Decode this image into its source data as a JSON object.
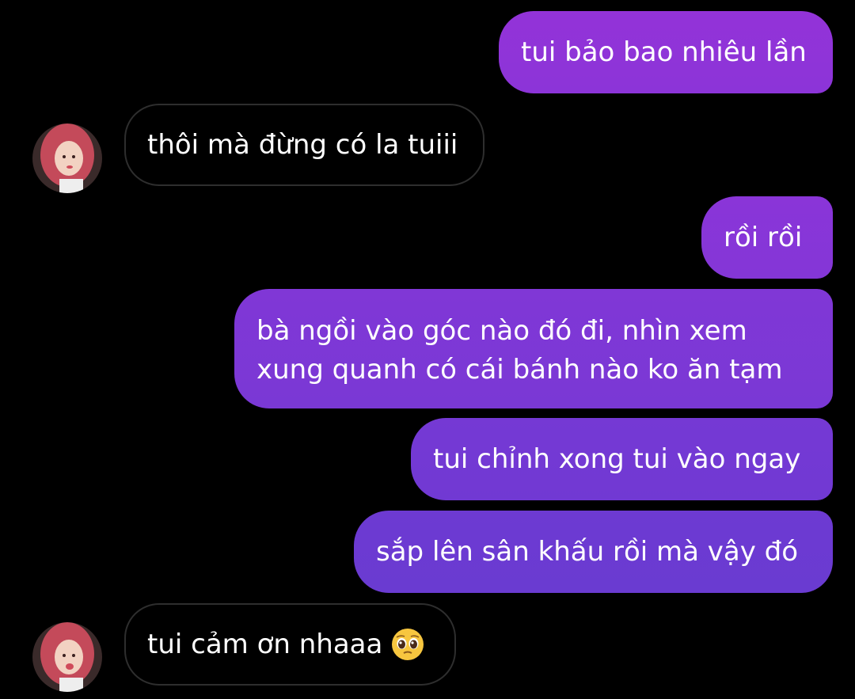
{
  "colors": {
    "background": "#000000",
    "sent_bubble_top": "#9134d8",
    "sent_bubble_bottom": "#6a3fd0",
    "received_border": "#2e2e2e"
  },
  "messages": [
    {
      "direction": "sent",
      "text": "tui bảo bao nhiêu lần"
    },
    {
      "direction": "received",
      "text": "thôi mà đừng có la tuiii",
      "avatar": "contact-avatar"
    },
    {
      "direction": "sent",
      "text": "rồi rồi"
    },
    {
      "direction": "sent",
      "lines": [
        "bà ngồi vào góc nào đó đi, nhìn xem",
        "xung quanh có cái bánh nào ko ăn tạm"
      ]
    },
    {
      "direction": "sent",
      "text": "tui chỉnh xong tui vào ngay"
    },
    {
      "direction": "sent",
      "text": "sắp lên sân khấu rồi mà vậy đó"
    },
    {
      "direction": "received",
      "text": "tui cảm ơn nhaaa",
      "emoji": "pleading-face-emoji",
      "avatar": "contact-avatar"
    }
  ]
}
